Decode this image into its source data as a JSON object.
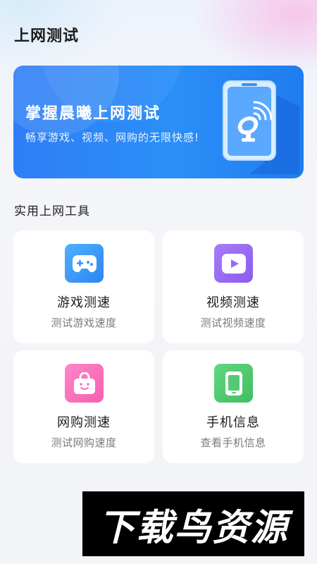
{
  "app": {
    "title": "上网测试"
  },
  "banner": {
    "title": "掌握晨曦上网测试",
    "subtitle": "畅享游戏、视频、网购的无限快感!",
    "illustration_icon": "phone-satellite-dish-icon"
  },
  "tools": {
    "section_title": "实用上网工具",
    "items": [
      {
        "title": "游戏测速",
        "subtitle": "测试游戏速度",
        "icon": "gamepad-icon",
        "color": "#3a94f6"
      },
      {
        "title": "视频测速",
        "subtitle": "测试视频速度",
        "icon": "video-play-icon",
        "color": "#9a6cf4"
      },
      {
        "title": "网购测速",
        "subtitle": "测试网购速度",
        "icon": "shopping-bag-icon",
        "color": "#f872bd"
      },
      {
        "title": "手机信息",
        "subtitle": "查看手机信息",
        "icon": "phone-icon",
        "color": "#52cb72"
      }
    ]
  },
  "watermark": {
    "text": "下载鸟资源"
  }
}
